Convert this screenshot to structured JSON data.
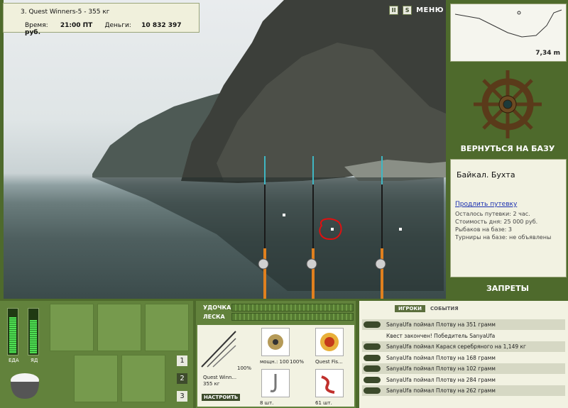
{
  "quest": {
    "title": "3. Quest Winners-5 - 355 кг"
  },
  "status": {
    "time_label": "Время:",
    "time_value": "21:00 ПТ",
    "money_label": "Деньги:",
    "money_value": "10 832 397 руб."
  },
  "top_buttons": {
    "pause": "II",
    "sound": "S",
    "menu": "МЕНЮ"
  },
  "depth": {
    "value": "7,34 m"
  },
  "nav": {
    "return_label": "ВЕРНУТЬСЯ НА БАЗУ",
    "bans_label": "ЗАПРЕТЫ"
  },
  "location": {
    "title": "Байкал. Бухта",
    "extend_link": "Продлить путевку",
    "lines": [
      "Осталось путевки: 2 час.",
      "Стоимость дня: 25 000 руб.",
      "Рыбаков на базе: 3",
      "Турниры на базе: не объявлены"
    ]
  },
  "meters": {
    "food_label": "ЕДА",
    "poison_label": "ЯД",
    "food_level": 0.78,
    "poison_level": 0.72
  },
  "inventory_pages": [
    "1",
    "2",
    "3"
  ],
  "tackle": {
    "rod_label": "УДОЧКА",
    "line_label": "ЛЕСКА",
    "rod_name": "Quest Winn...",
    "rod_weight": "355 кг",
    "rod_percent": "100%",
    "reel_power": "мощн.: 100",
    "reel_percent": "100%",
    "line_name": "Quest Fis...",
    "hook_count": "8 шт.",
    "bait_count": "61 шт.",
    "setup_button": "НАСТРОИТЬ"
  },
  "log": {
    "tabs": [
      "ИГРОКИ",
      "СОБЫТИЯ"
    ],
    "entries": [
      {
        "text": "SanyaUfa поймал Плотву на 351 грамм",
        "icon": "fish-icon"
      },
      {
        "text": "Квест закончен! Победитель SanyaUfa",
        "icon": ""
      },
      {
        "text": "SanyaUfa поймал Карася серебряного на 1,149 кг",
        "icon": "fish-icon"
      },
      {
        "text": "SanyaUfa поймал Плотву на 168 грамм",
        "icon": "fish-icon"
      },
      {
        "text": "SanyaUfa поймал Плотву на 102 грамм",
        "icon": "fish-icon"
      },
      {
        "text": "SanyaUfa поймал Плотву на 284 грамм",
        "icon": "fish-icon"
      },
      {
        "text": "SanyaUfa поймал Плотву на 262 грамм",
        "icon": "fish-icon"
      }
    ]
  }
}
